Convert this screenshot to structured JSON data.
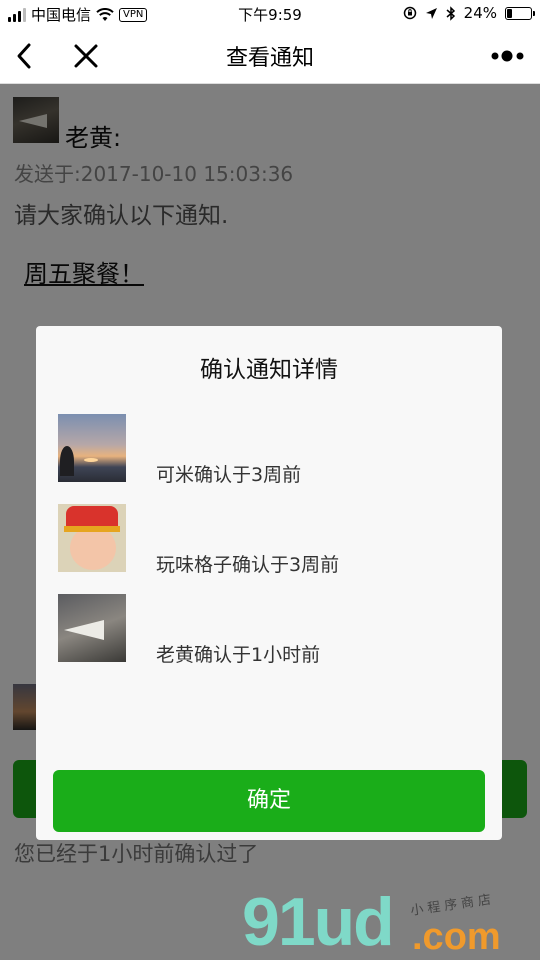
{
  "status_bar": {
    "carrier": "中国电信",
    "vpn": "VPN",
    "time": "下午9:59",
    "battery": "24%",
    "battery_level": 0.24,
    "signal_bars_on": 3,
    "signal_bars_total": 4
  },
  "nav": {
    "title": "查看通知",
    "back_icon": "chevron-left-icon",
    "close_icon": "close-icon",
    "more_icon": "more-dots-icon"
  },
  "notice": {
    "sender_name": "老黄:",
    "sent_time": "发送于:2017-10-10 15:03:36",
    "text": "请大家确认以下通知.",
    "link_text": "周五聚餐！",
    "confirmed_note": "您已经于1小时前确认过了"
  },
  "modal": {
    "title": "确认通知详情",
    "records": [
      {
        "text": "可米确认于3周前",
        "avatar": "sunset-avatar"
      },
      {
        "text": "玩味格子确认于3周前",
        "avatar": "baby-avatar"
      },
      {
        "text": "老黄确认于1小时前",
        "avatar": "paper-plane-avatar"
      }
    ],
    "ok_label": "确定"
  },
  "watermark": {
    "main": "91ud",
    "domain": ".com",
    "sub": "小程序商店"
  },
  "colors": {
    "accent_green": "#1aad19",
    "overlay": "rgba(0,0,0,0.5)"
  }
}
